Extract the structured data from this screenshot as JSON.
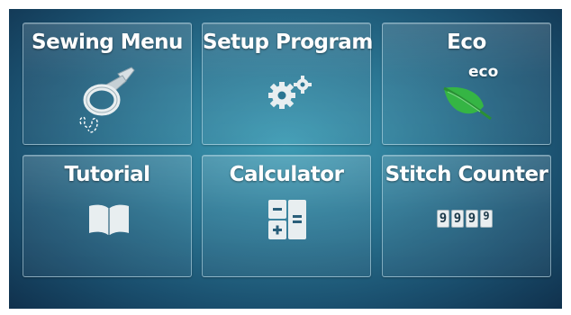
{
  "menu": {
    "tiles": [
      {
        "label": "Sewing Menu",
        "icon": "presser-foot-icon"
      },
      {
        "label": "Setup Program",
        "icon": "gears-icon"
      },
      {
        "label": "Eco",
        "sublabel": "eco",
        "icon": "leaf-icon"
      },
      {
        "label": "Tutorial",
        "icon": "book-icon"
      },
      {
        "label": "Calculator",
        "icon": "calculator-icon"
      },
      {
        "label": "Stitch Counter",
        "icon": "counter-icon",
        "digits": [
          "9",
          "9",
          "9",
          "9"
        ]
      }
    ]
  },
  "colors": {
    "background": "#2a7592",
    "tile_border": "#c8e6f0",
    "leaf": "#35b544",
    "icon": "#e8eef0"
  }
}
